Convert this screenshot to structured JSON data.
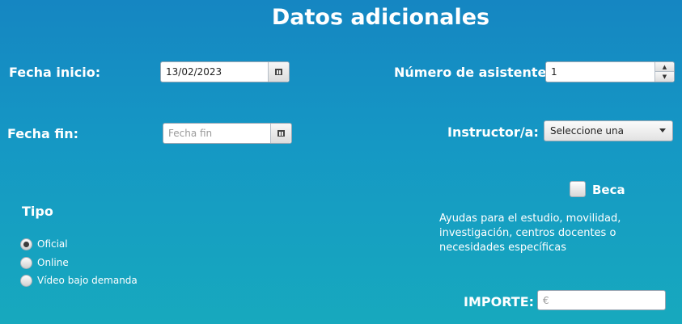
{
  "title": "Datos adicionales",
  "fecha_inicio": {
    "label": "Fecha inicio:",
    "value": "13/02/2023",
    "icon": "calendar-icon"
  },
  "fecha_fin": {
    "label": "Fecha fin:",
    "value": "",
    "placeholder": "Fecha fin",
    "icon": "calendar-icon"
  },
  "asistentes": {
    "label": "Número de asistentes:",
    "value": "1",
    "up": "▲",
    "down": "▼"
  },
  "instructor": {
    "label": "Instructor/a:",
    "selected": "Seleccione una"
  },
  "beca": {
    "label": "Beca",
    "checked": false,
    "description": [
      "Ayudas para el estudio, movilidad,",
      "investigación, centros docentes o",
      "necesidades específicas"
    ]
  },
  "tipo": {
    "label": "Tipo",
    "options": [
      {
        "label": "Oficial",
        "selected": true
      },
      {
        "label": "Online",
        "selected": false
      },
      {
        "label": "Vídeo bajo demanda",
        "selected": false
      }
    ]
  },
  "importe": {
    "label": "IMPORTE:",
    "value": "",
    "placeholder": "€"
  }
}
